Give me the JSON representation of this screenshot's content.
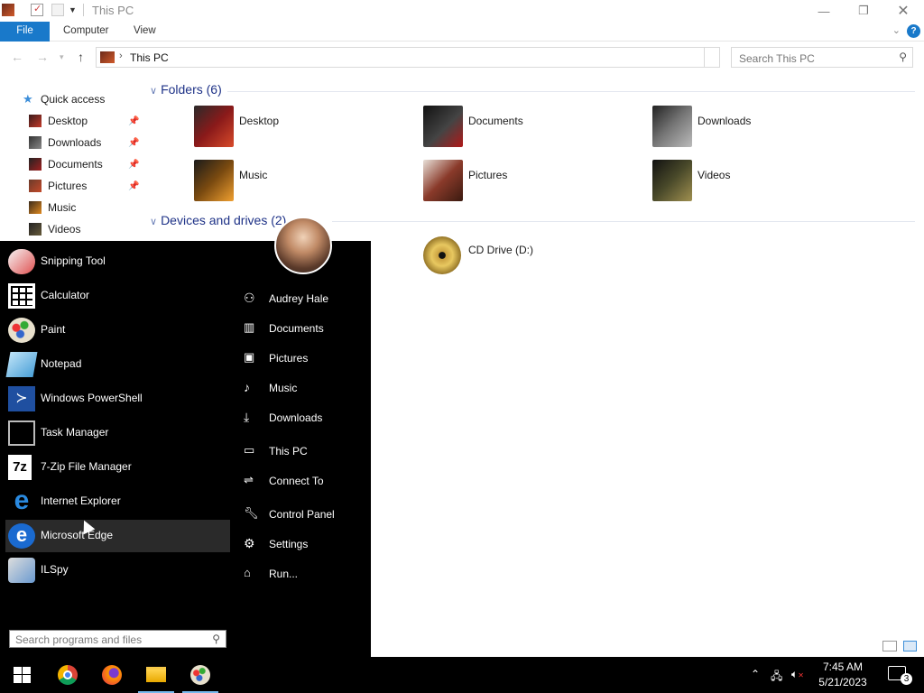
{
  "window": {
    "title": "This PC"
  },
  "ribbon": {
    "tabs": [
      "File",
      "Computer",
      "View"
    ],
    "help": "?"
  },
  "address": {
    "path": "This PC",
    "search_placeholder": "Search This PC"
  },
  "navpane": {
    "quick_access": "Quick access",
    "items": [
      "Desktop",
      "Downloads",
      "Documents",
      "Pictures",
      "Music",
      "Videos"
    ]
  },
  "folders": {
    "header": "Folders (6)",
    "items": [
      "Desktop",
      "Documents",
      "Downloads",
      "Music",
      "Pictures",
      "Videos"
    ]
  },
  "drives": {
    "header": "Devices and drives (2)",
    "items": [
      "CD Drive (D:)"
    ]
  },
  "start_menu": {
    "programs": [
      "Snipping Tool",
      "Calculator",
      "Paint",
      "Notepad",
      "Windows PowerShell",
      "Task Manager",
      "7-Zip File Manager",
      "Internet Explorer",
      "Microsoft Edge",
      "ILSpy"
    ],
    "places": [
      "Audrey Hale",
      "Documents",
      "Pictures",
      "Music",
      "Downloads",
      "This PC",
      "Connect To",
      "Control Panel",
      "Settings",
      "Run..."
    ],
    "search_placeholder": "Search programs and files"
  },
  "taskbar": {
    "time": "7:45 AM",
    "date": "5/21/2023",
    "notifications": "3"
  },
  "colors": {
    "accent": "#1979ca",
    "start_bg": "#000000",
    "group_header": "#1e3287"
  }
}
